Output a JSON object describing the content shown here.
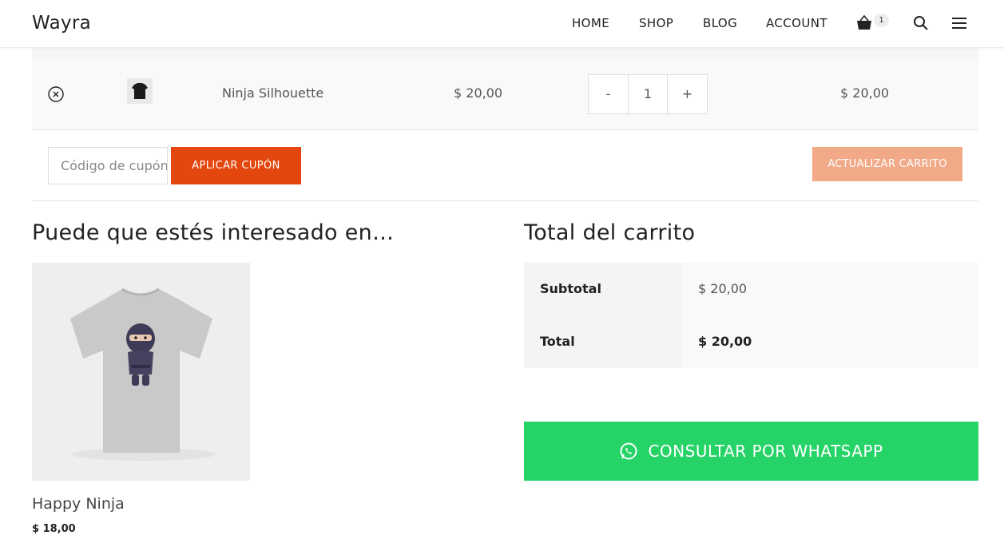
{
  "header": {
    "logo": "Wayra",
    "nav": [
      "HOME",
      "SHOP",
      "BLOG",
      "ACCOUNT"
    ],
    "cart_count": "1",
    "icons": [
      "cart-icon",
      "search-icon",
      "menu-icon"
    ]
  },
  "cart": {
    "items": [
      {
        "name": "Ninja Silhouette",
        "price": "$ 20,00",
        "quantity": "1",
        "total": "$ 20,00",
        "qty_minus": "-",
        "qty_plus": "+"
      }
    ],
    "coupon_placeholder": "Código de cupón",
    "apply_coupon": "APLICAR CUPÓN",
    "update_cart": "ACTUALIZAR CARRITO"
  },
  "cross_sells": {
    "title": "Puede que estés interesado en…",
    "products": [
      {
        "name": "Happy Ninja",
        "price": "$ 18,00"
      }
    ]
  },
  "totals": {
    "title": "Total del carrito",
    "rows": [
      {
        "label": "Subtotal",
        "value": "$ 20,00"
      },
      {
        "label": "Total",
        "value": "$ 20,00"
      }
    ]
  },
  "whatsapp": {
    "label": "CONSULTAR POR WHATSAPP"
  },
  "colors": {
    "accent": "#e4470d",
    "update_button": "#f1a988",
    "whatsapp": "#25d366"
  }
}
